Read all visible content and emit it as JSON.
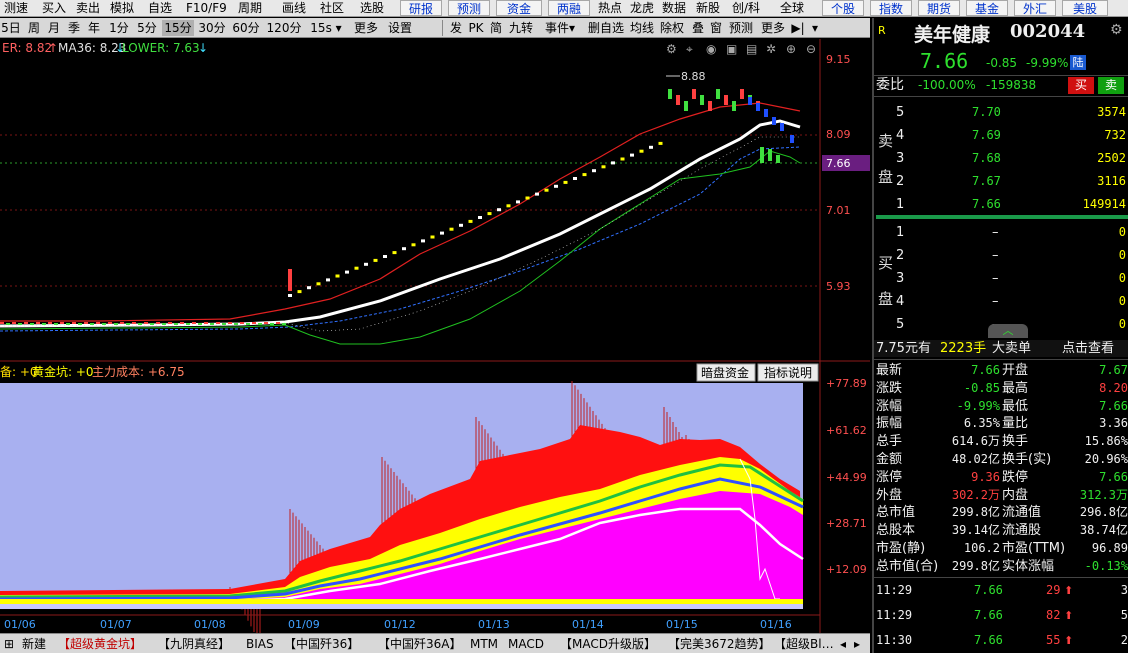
{
  "toolbar": {
    "items": [
      "测速",
      "买入",
      "卖出",
      "模拟",
      "自选",
      "F10/F9",
      "周期",
      "画线",
      "社区",
      "选股"
    ],
    "buttons": [
      "研报",
      "预测",
      "资金",
      "两融",
      "热点",
      "龙虎",
      "数据",
      "新股",
      "创/科",
      "全球",
      "个股",
      "指数",
      "期货",
      "基金",
      "外汇",
      "美股"
    ]
  },
  "periods": {
    "items": [
      "5日",
      "周",
      "月",
      "季",
      "年",
      "1分",
      "5分",
      "15分",
      "30分",
      "60分",
      "120分",
      "15s",
      "更多",
      "设置"
    ],
    "selected": "15分",
    "tools": [
      "发",
      "PK",
      "简",
      "九转",
      "事件",
      "删自选",
      "均线",
      "除权",
      "叠",
      "窗",
      "预测",
      "更多"
    ]
  },
  "indicator_top": {
    "upper": "ER: 8.82",
    "ma": "MA36: 8.23",
    "lower": "LOWER: 7.63"
  },
  "price_axis": [
    "9.15",
    "8.09",
    "7.66",
    "7.01",
    "5.93"
  ],
  "current_price_tag": "7.66",
  "hi_label": "8.88",
  "lower_panel": {
    "title_a": "备: +0",
    "title_b": "黄金坑: +0",
    "title_c": "主力成本: +6.75",
    "btn_dark": "暗盘资金",
    "btn_help": "指标说明",
    "axis": [
      "+77.89",
      "+61.62",
      "+44.99",
      "+28.71",
      "+12.09"
    ]
  },
  "dates": [
    "01/06",
    "01/07",
    "01/08",
    "01/09",
    "01/12",
    "01/13",
    "01/14",
    "01/15",
    "01/16"
  ],
  "bottom_tabs": [
    "新建",
    "【超级黄金坑】",
    "【九阴真经】",
    "BIAS",
    "【中国歼36】",
    "【中国歼36A】",
    "MTM",
    "MACD",
    "【MACD升级版】",
    "【完美3672趋势】",
    "【超级Bl…"
  ],
  "stock": {
    "mark": "R",
    "name": "美年健康",
    "code": "002044",
    "price": "7.66",
    "change": "-0.85",
    "pct": "-9.99%",
    "lu": "陆"
  },
  "weibi": {
    "label": "委比",
    "value": "-100.00%",
    "diff": "-159838",
    "buy": "买",
    "sell": "卖"
  },
  "sell_side_label": [
    "卖",
    "盘"
  ],
  "buy_side_label": [
    "买",
    "盘"
  ],
  "sell_book": [
    {
      "lvl": "5",
      "price": "7.70",
      "vol": "3574"
    },
    {
      "lvl": "4",
      "price": "7.69",
      "vol": "732"
    },
    {
      "lvl": "3",
      "price": "7.68",
      "vol": "2502"
    },
    {
      "lvl": "2",
      "price": "7.67",
      "vol": "3116"
    },
    {
      "lvl": "1",
      "price": "7.66",
      "vol": "149914"
    }
  ],
  "buy_book": [
    {
      "lvl": "1",
      "price": "–",
      "vol": "0"
    },
    {
      "lvl": "2",
      "price": "–",
      "vol": "0"
    },
    {
      "lvl": "3",
      "price": "–",
      "vol": "0"
    },
    {
      "lvl": "4",
      "price": "–",
      "vol": "0"
    },
    {
      "lvl": "5",
      "price": "–",
      "vol": "0"
    }
  ],
  "bigorder": {
    "a": "7.75元有",
    "b": "2223手",
    "c": "大卖单",
    "d": "点击查看"
  },
  "quotes": [
    [
      "最新",
      "7.66",
      "开盘",
      "7.67"
    ],
    [
      "涨跌",
      "-0.85",
      "最高",
      "8.20"
    ],
    [
      "涨幅",
      "-9.99%",
      "最低",
      "7.66"
    ],
    [
      "振幅",
      "6.35%",
      "量比",
      "3.36"
    ],
    [
      "总手",
      "614.6万",
      "换手",
      "15.86%"
    ],
    [
      "金额",
      "48.02亿",
      "换手(实)",
      "20.96%"
    ],
    [
      "涨停",
      "9.36",
      "跌停",
      "7.66"
    ],
    [
      "外盘",
      "302.2万",
      "内盘",
      "312.3万"
    ],
    [
      "总市值",
      "299.8亿",
      "流通值",
      "296.8亿"
    ],
    [
      "总股本",
      "39.14亿",
      "流通股",
      "38.74亿"
    ],
    [
      "市盈(静)",
      "106.2",
      "市盈(TTM)",
      "96.89"
    ],
    [
      "总市值(合)",
      "299.8亿",
      "实体涨幅",
      "-0.13%"
    ]
  ],
  "ticks": [
    {
      "time": "11:29",
      "price": "7.66",
      "vol": "29",
      "n": "3"
    },
    {
      "time": "11:29",
      "price": "7.66",
      "vol": "82",
      "n": "5"
    },
    {
      "time": "11:30",
      "price": "7.66",
      "vol": "55",
      "n": "2"
    }
  ],
  "colors": {
    "up": "#ff4040",
    "down": "#2ee02e",
    "magenta": "#ff00ff",
    "yellow": "#ffff00",
    "sky": "#a8b0f0"
  }
}
